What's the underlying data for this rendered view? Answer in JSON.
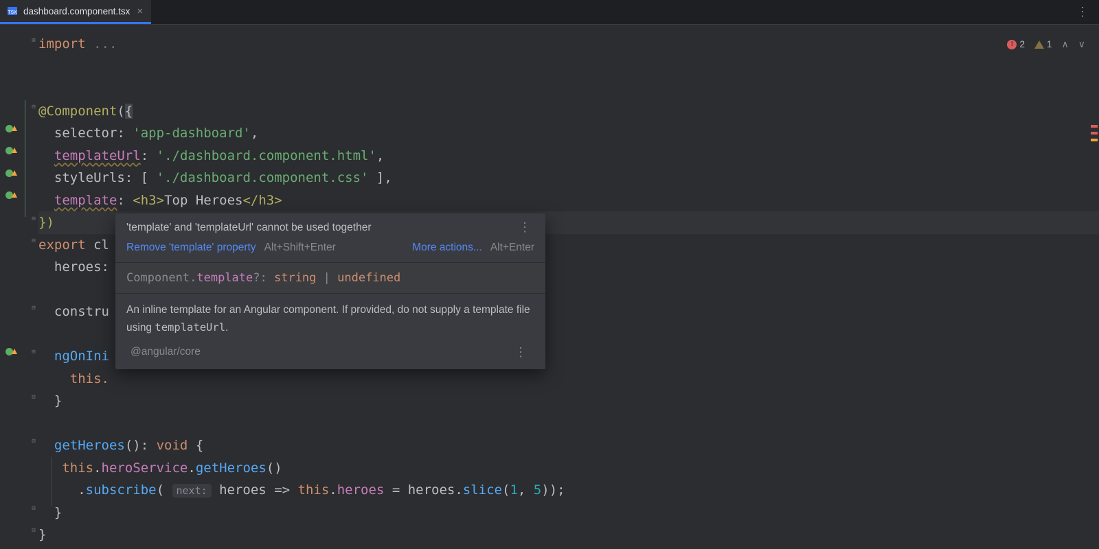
{
  "tab": {
    "filename": "dashboard.component.tsx"
  },
  "status": {
    "errors": "2",
    "warnings": "1"
  },
  "code": {
    "l1_import": "import",
    "l1_dots": " ...",
    "l3_dec": "@Component",
    "l3_paren": "(",
    "l3_brace": "{",
    "l4_key": "selector",
    "l4_val": "'app-dashboard'",
    "l5_key": "templateUrl",
    "l5_val": "'./dashboard.component.html'",
    "l6_key": "styleUrls",
    "l6_val": "'./dashboard.component.css'",
    "l7_key": "template",
    "l7_h3o": "<h3>",
    "l7_txt": "Top Heroes",
    "l7_h3c": "</h3>",
    "l8_close": "})",
    "l9_export": "export",
    "l9_cl": " cl",
    "l10_heroes": "heroes:",
    "l12_ctor": "constru",
    "l14_ng": "ngOnIni",
    "l15_this": "this.",
    "l16_cb": "}",
    "l18_fn": "getHeroes",
    "l18_void": "void",
    "l19_this": "this",
    "l19_svc": "heroService",
    "l19_get": "getHeroes",
    "l20_sub": "subscribe",
    "l20_hint": "next:",
    "l20_arg": "heroes",
    "l20_arrow": " => ",
    "l20_this": "this",
    "l20_prop": "heroes",
    "l20_eq": " = ",
    "l20_var": "heroes",
    "l20_slice": "slice",
    "l20_n1": "1",
    "l20_n2": "5",
    "l21_cb": "}",
    "l22_cb": "}"
  },
  "popup": {
    "title": "'template' and 'templateUrl' cannot be used together",
    "fix": "Remove 'template' property",
    "fix_short": "Alt+Shift+Enter",
    "more": "More actions...",
    "more_short": "Alt+Enter",
    "sig_owner": "Component",
    "sig_prop": "template",
    "sig_q": "?: ",
    "sig_t1": "string",
    "sig_pipe": " | ",
    "sig_t2": "undefined",
    "doc1": "An inline template for an Angular component. If provided, do not supply a template file using ",
    "doc_code": "templateUrl",
    "doc2": ".",
    "src": "@angular/core"
  }
}
